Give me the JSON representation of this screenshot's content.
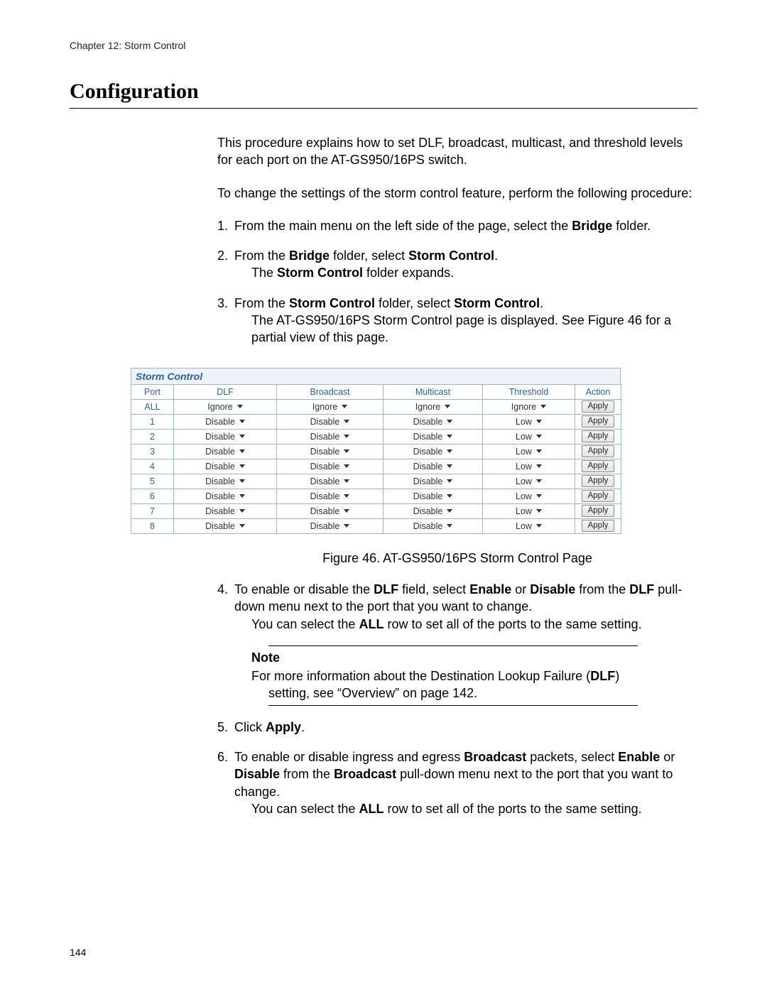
{
  "chapter_header": "Chapter 12: Storm Control",
  "section_title": "Configuration",
  "intro_para": "This procedure explains how to set DLF, broadcast, multicast, and threshold levels for each port on the AT-GS950/16PS switch.",
  "lead_para": "To change the settings of the storm control feature, perform the following procedure:",
  "step1_a": "From the main menu on the left side of the page, select the ",
  "step1_bold": "Bridge",
  "step1_b": " folder.",
  "step2_a": "From the ",
  "step2_bold1": "Bridge",
  "step2_b": " folder, select ",
  "step2_bold2": "Storm Control",
  "step2_c": ".",
  "step2_d_a": "The ",
  "step2_d_bold": "Storm Control",
  "step2_d_b": " folder expands.",
  "step3_a": "From the ",
  "step3_bold1": "Storm Control",
  "step3_b": " folder, select ",
  "step3_bold2": "Storm Control",
  "step3_c": ".",
  "step3_d": "The AT-GS950/16PS Storm Control page is displayed. See Figure 46 for a partial view of this page.",
  "storm_header": "Storm Control",
  "table": {
    "headers": {
      "port": "Port",
      "dlf": "DLF",
      "broadcast": "Broadcast",
      "multicast": "Multicast",
      "threshold": "Threshold",
      "action": "Action"
    },
    "rows": [
      {
        "port": "ALL",
        "dlf": "Ignore",
        "broadcast": "Ignore",
        "multicast": "Ignore",
        "threshold": "Ignore",
        "action": "Apply"
      },
      {
        "port": "1",
        "dlf": "Disable",
        "broadcast": "Disable",
        "multicast": "Disable",
        "threshold": "Low",
        "action": "Apply"
      },
      {
        "port": "2",
        "dlf": "Disable",
        "broadcast": "Disable",
        "multicast": "Disable",
        "threshold": "Low",
        "action": "Apply"
      },
      {
        "port": "3",
        "dlf": "Disable",
        "broadcast": "Disable",
        "multicast": "Disable",
        "threshold": "Low",
        "action": "Apply"
      },
      {
        "port": "4",
        "dlf": "Disable",
        "broadcast": "Disable",
        "multicast": "Disable",
        "threshold": "Low",
        "action": "Apply"
      },
      {
        "port": "5",
        "dlf": "Disable",
        "broadcast": "Disable",
        "multicast": "Disable",
        "threshold": "Low",
        "action": "Apply"
      },
      {
        "port": "6",
        "dlf": "Disable",
        "broadcast": "Disable",
        "multicast": "Disable",
        "threshold": "Low",
        "action": "Apply"
      },
      {
        "port": "7",
        "dlf": "Disable",
        "broadcast": "Disable",
        "multicast": "Disable",
        "threshold": "Low",
        "action": "Apply"
      },
      {
        "port": "8",
        "dlf": "Disable",
        "broadcast": "Disable",
        "multicast": "Disable",
        "threshold": "Low",
        "action": "Apply"
      }
    ]
  },
  "figure_caption": "Figure 46. AT-GS950/16PS Storm Control Page",
  "step4_a": "To enable or disable the ",
  "step4_bold1": "DLF",
  "step4_b": " field, select ",
  "step4_bold2": "Enable",
  "step4_c": " or ",
  "step4_bold3": "Disable",
  "step4_d": " from the ",
  "step4_bold4": "DLF",
  "step4_e": " pull-down menu next to the port that you want to change.",
  "step4_f_a": "You can select the ",
  "step4_f_bold": "ALL",
  "step4_f_b": " row to set all of the ports to the same setting.",
  "note_label": "Note",
  "note_body_a": "For more information about the Destination Lookup Failure (",
  "note_body_bold": "DLF",
  "note_body_b": ") setting, see “Overview” on page 142.",
  "step5_a": "Click ",
  "step5_bold": "Apply",
  "step5_b": ".",
  "step6_a": "To enable or disable ingress and egress ",
  "step6_bold1": "Broadcast",
  "step6_b": " packets, select ",
  "step6_bold2": "Enable",
  "step6_c": " or ",
  "step6_bold3": "Disable",
  "step6_d": " from the ",
  "step6_bold4": "Broadcast",
  "step6_e": " pull-down menu next to the port that you want to change.",
  "step6_f_a": "You can select the ",
  "step6_f_bold": "ALL",
  "step6_f_b": " row to set all of the ports to the same setting.",
  "page_number": "144"
}
